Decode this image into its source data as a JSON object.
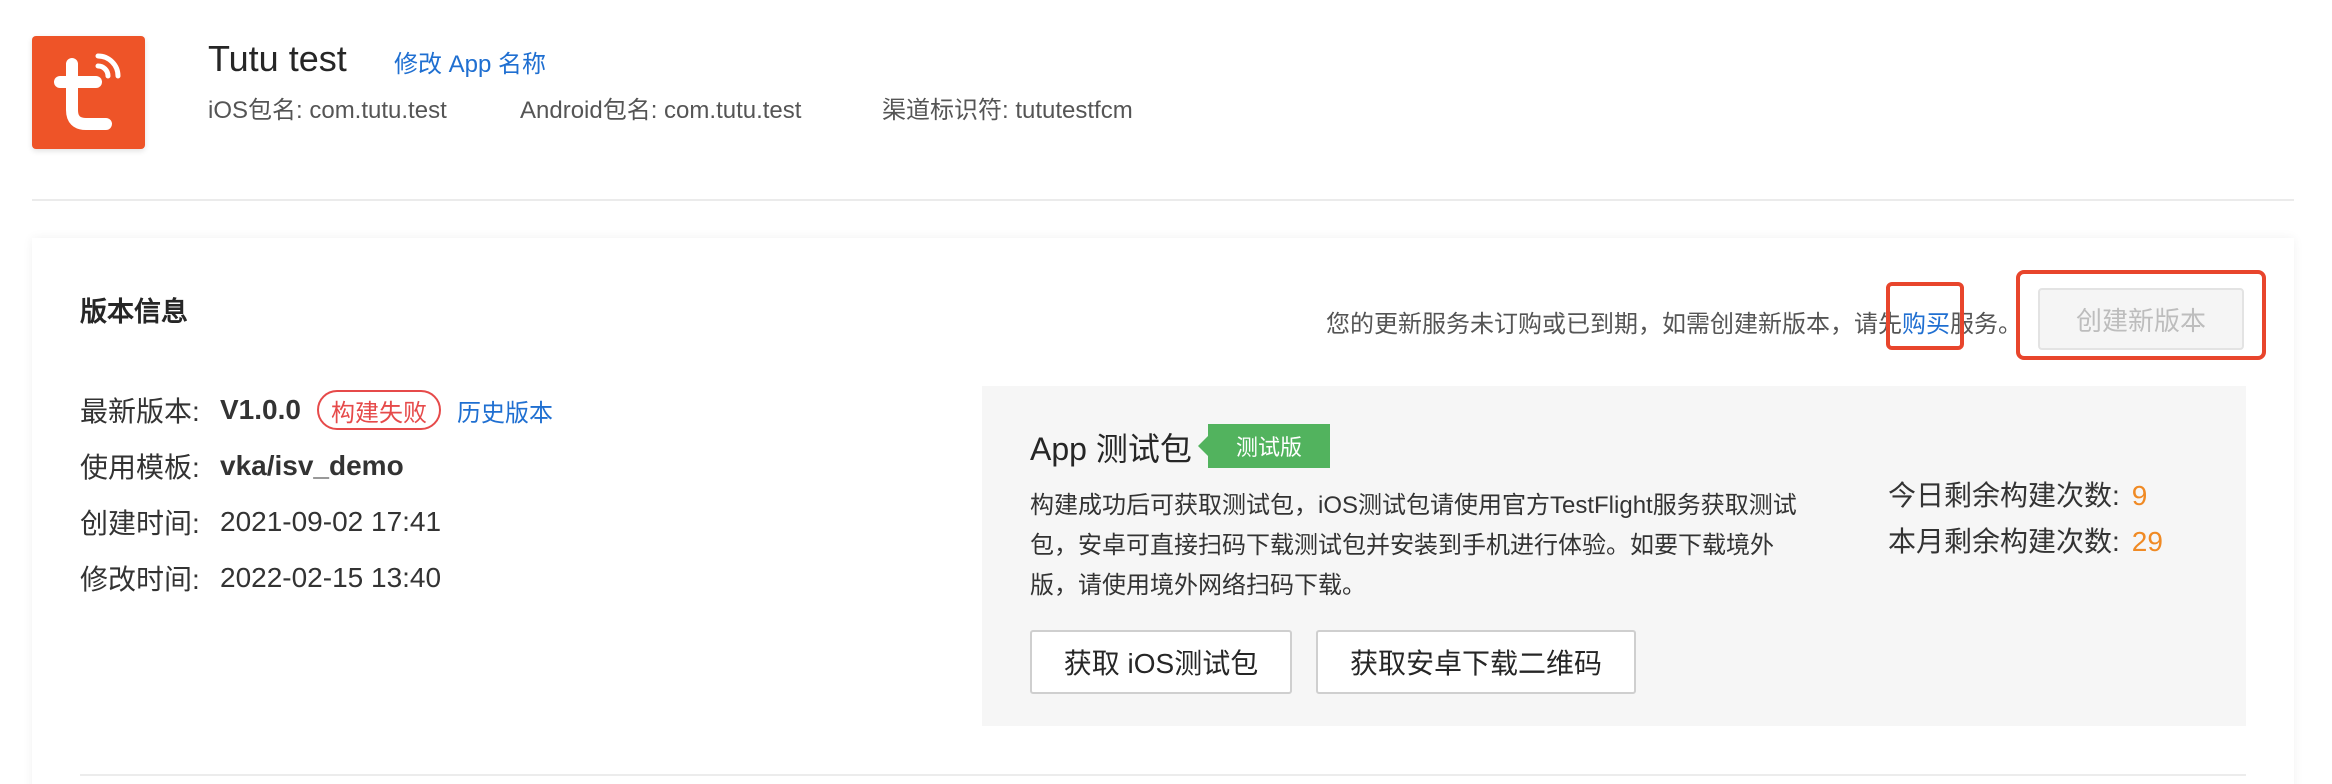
{
  "header": {
    "app_name": "Tutu test",
    "rename_link": "修改 App 名称",
    "ios_package": "iOS包名: com.tutu.test",
    "android_package": "Android包名: com.tutu.test",
    "channel_id": "渠道标识符: tututestfcm",
    "logo_icon": "tuya-t-logo-icon",
    "logo_color": "#ee5428"
  },
  "version_section": {
    "title": "版本信息",
    "notice_prefix": "您的更新服务未订购或已到期，如需创建新版本，请先",
    "notice_buy": "购买",
    "notice_suffix": "服务。",
    "create_button": "创建新版本",
    "latest_label": "最新版本:",
    "latest_value": "V1.0.0",
    "status_badge": "构建失败",
    "history_link": "历史版本",
    "template_label": "使用模板:",
    "template_value": "vka/isv_demo",
    "created_label": "创建时间:",
    "created_value": "2021-09-02 17:41",
    "modified_label": "修改时间:",
    "modified_value": "2022-02-15 13:40"
  },
  "test_package": {
    "title": "App 测试包",
    "badge": "测试版",
    "description": "构建成功后可获取测试包，iOS测试包请使用官方TestFlight服务获取测试包，安卓可直接扫码下载测试包并安装到手机进行体验。如要下载境外版，请使用境外网络扫码下载。",
    "ios_button": "获取 iOS测试包",
    "android_button": "获取安卓下载二维码",
    "today_label": "今日剩余构建次数:",
    "today_value": "9",
    "month_label": "本月剩余构建次数:",
    "month_value": "29"
  },
  "colors": {
    "link": "#1f6fd1",
    "fail": "#e64a4a",
    "badge_green": "#52b35e",
    "count_orange": "#f08a24",
    "highlight_red": "#e8452c"
  }
}
